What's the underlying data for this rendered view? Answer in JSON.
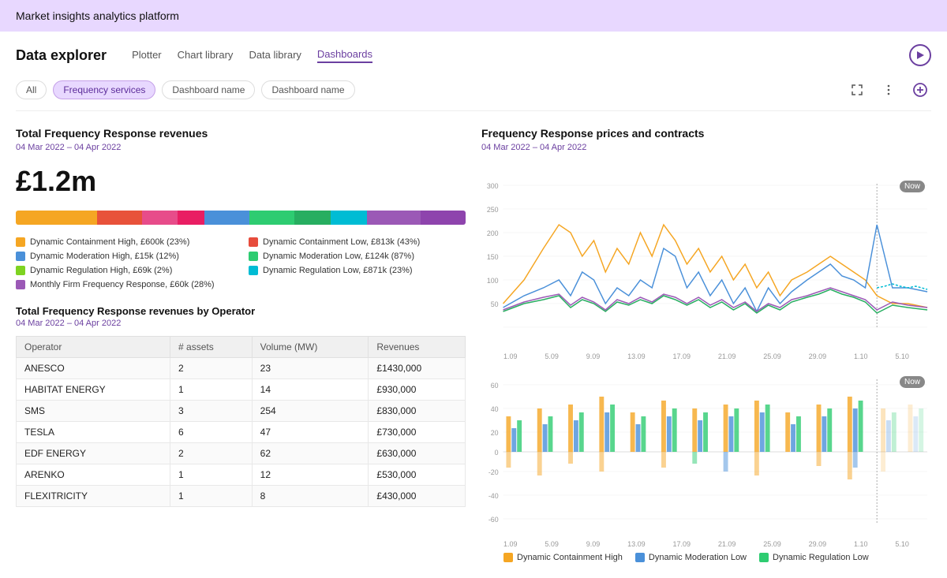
{
  "app": {
    "title": "Market insights analytics platform"
  },
  "nav": {
    "title": "Data explorer",
    "tabs": [
      {
        "id": "plotter",
        "label": "Plotter",
        "active": false
      },
      {
        "id": "chart-library",
        "label": "Chart library",
        "active": false
      },
      {
        "id": "data-library",
        "label": "Data library",
        "active": false
      },
      {
        "id": "dashboards",
        "label": "Dashboards",
        "active": true
      }
    ]
  },
  "filters": {
    "buttons": [
      {
        "id": "all",
        "label": "All",
        "active": false
      },
      {
        "id": "frequency-services",
        "label": "Frequency services",
        "active": true
      },
      {
        "id": "dashboard-name-1",
        "label": "Dashboard name",
        "active": false
      },
      {
        "id": "dashboard-name-2",
        "label": "Dashboard name",
        "active": false
      }
    ]
  },
  "panel_left": {
    "title": "Total Frequency Response revenues",
    "date_range": "04 Mar 2022 – 04 Apr 2022",
    "big_number": "£1.2m",
    "color_bar": [
      {
        "color": "#f5a623",
        "pct": 18
      },
      {
        "color": "#e74c3c",
        "pct": 12
      },
      {
        "color": "#4a90d9",
        "pct": 10
      },
      {
        "color": "#e91e63",
        "pct": 8
      },
      {
        "color": "#2ecc71",
        "pct": 10
      },
      {
        "color": "#27ae60",
        "pct": 10
      },
      {
        "color": "#1abc9c",
        "pct": 8
      },
      {
        "color": "#9b59b6",
        "pct": 12
      },
      {
        "color": "#8e44ad",
        "pct": 12
      }
    ],
    "legend": [
      {
        "color": "#f5a623",
        "label": "Dynamic Containment High, £600k (23%)"
      },
      {
        "color": "#e74c3c",
        "label": "Dynamic Containment Low, £813k (43%)"
      },
      {
        "color": "#4a90d9",
        "label": "Dynamic Moderation High, £15k (12%)"
      },
      {
        "color": "#2ecc71",
        "label": "Dynamic Moderation Low, £124k (87%)"
      },
      {
        "color": "#7ed321",
        "label": "Dynamic Regulation High, £69k (2%)"
      },
      {
        "color": "#00bcd4",
        "label": "Dynamic Regulation Low, £871k (23%)"
      },
      {
        "color": "#9b59b6",
        "label": "Monthly Firm Frequency Response, £60k (28%)"
      }
    ]
  },
  "table": {
    "title": "Total Frequency Response revenues by Operator",
    "date_range": "04 Mar 2022 – 04 Apr 2022",
    "columns": [
      "Operator",
      "# assets",
      "Volume (MW)",
      "Revenues"
    ],
    "rows": [
      {
        "operator": "ANESCO",
        "assets": "2",
        "volume": "23",
        "revenues": "£1430,000"
      },
      {
        "operator": "HABITAT ENERGY",
        "assets": "1",
        "volume": "14",
        "revenues": "£930,000"
      },
      {
        "operator": "SMS",
        "assets": "3",
        "volume": "254",
        "revenues": "£830,000"
      },
      {
        "operator": "TESLA",
        "assets": "6",
        "volume": "47",
        "revenues": "£730,000"
      },
      {
        "operator": "EDF ENERGY",
        "assets": "2",
        "volume": "62",
        "revenues": "£630,000"
      },
      {
        "operator": "ARENKO",
        "assets": "1",
        "volume": "12",
        "revenues": "£530,000"
      },
      {
        "operator": "FLEXITRICITY",
        "assets": "1",
        "volume": "8",
        "revenues": "£430,000"
      }
    ]
  },
  "panel_right": {
    "title": "Frequency Response prices and contracts",
    "date_range": "04 Mar 2022 – 04 Apr 2022",
    "chart_top": {
      "y_labels": [
        "300",
        "250",
        "200",
        "150",
        "100",
        "50",
        ""
      ],
      "x_labels": [
        "1.09",
        "5.09",
        "9.09",
        "13.09",
        "17.09",
        "21.09",
        "25.09",
        "29.09",
        "1.10",
        "5.10"
      ]
    },
    "chart_bottom": {
      "y_labels": [
        "60",
        "40",
        "20",
        "0",
        "-20",
        "-40",
        "-60"
      ],
      "x_labels": [
        "1.09",
        "5.09",
        "9.09",
        "13.09",
        "17.09",
        "21.09",
        "25.09",
        "29.09",
        "1.10",
        "5.10"
      ]
    },
    "bottom_legend": [
      {
        "color": "#f5a623",
        "label": "Dynamic Containment High"
      },
      {
        "color": "#4a90d9",
        "label": "Dynamic Moderation Low"
      },
      {
        "color": "#2ecc71",
        "label": "Dynamic Regulation Low"
      }
    ]
  }
}
